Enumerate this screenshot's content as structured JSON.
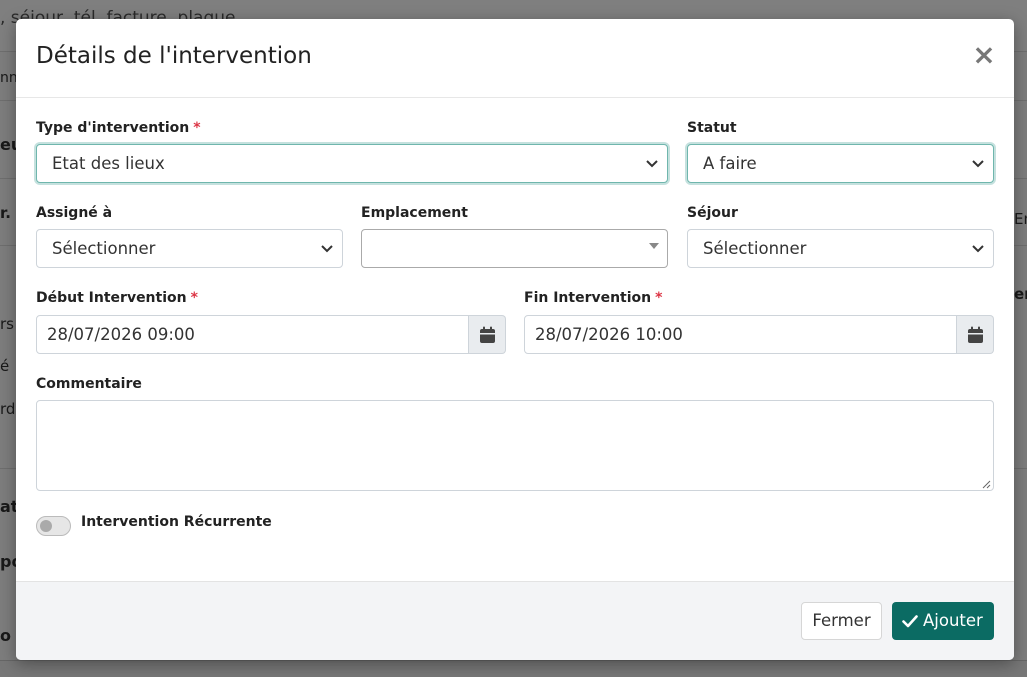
{
  "background": {
    "search_placeholder": ", séjour, tél, facture, plaque",
    "fragments": [
      "nn",
      "eu",
      "r.",
      "rs",
      "é",
      "rd",
      "at",
      "po",
      "o l",
      "En",
      "en"
    ]
  },
  "modal": {
    "title": "Détails de l'intervention",
    "close_symbol": "×",
    "fields": {
      "type": {
        "label": "Type d'intervention",
        "required_mark": "*",
        "value": "Etat des lieux"
      },
      "statut": {
        "label": "Statut",
        "value": "A faire"
      },
      "assigne": {
        "label": "Assigné à",
        "value": "Sélectionner"
      },
      "emplacement": {
        "label": "Emplacement",
        "value": ""
      },
      "sejour": {
        "label": "Séjour",
        "value": "Sélectionner"
      },
      "debut": {
        "label": "Début Intervention",
        "required_mark": "*",
        "value": "28/07/2026 09:00"
      },
      "fin": {
        "label": "Fin Intervention",
        "required_mark": "*",
        "value": "28/07/2026 10:00"
      },
      "commentaire": {
        "label": "Commentaire",
        "value": ""
      },
      "recurrente": {
        "label": "Intervention Récurrente",
        "checked": false
      }
    },
    "footer": {
      "close_label": "Fermer",
      "add_label": "Ajouter"
    }
  },
  "colors": {
    "primary": "#0b6b63",
    "required": "#dc3545",
    "focus_border": "#6fb6ad",
    "footer_bg": "#f3f4f6"
  },
  "icons": {
    "select_caret": "chevron-down-icon",
    "date_addon": "calendar-icon",
    "add_button": "check-icon",
    "close": "close-icon"
  }
}
